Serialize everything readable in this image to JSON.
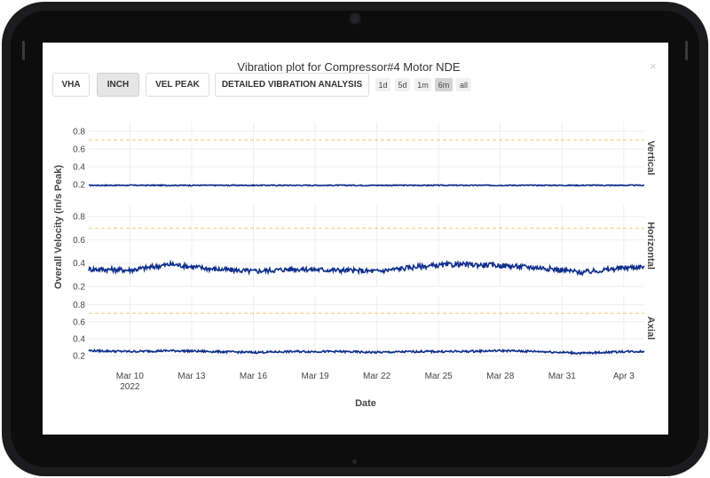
{
  "title": "Vibration plot for Compressor#4 Motor NDE",
  "close_icon": "×",
  "buttons": [
    {
      "label": "VHA",
      "active": false
    },
    {
      "label": "INCH",
      "active": true
    },
    {
      "label": "VEL PEAK",
      "active": false
    },
    {
      "label": "DETAILED VIBRATION ANALYSIS",
      "active": false
    }
  ],
  "range_selector": [
    {
      "label": "1d",
      "active": false
    },
    {
      "label": "5d",
      "active": false
    },
    {
      "label": "1m",
      "active": false
    },
    {
      "label": "6m",
      "active": true
    },
    {
      "label": "all",
      "active": false
    }
  ],
  "chart_data": {
    "type": "line",
    "ylabel": "Overall Velocity (in/s Peak)",
    "xlabel": "Date",
    "x_range": [
      "2022-03-08",
      "2022-04-04"
    ],
    "x_ticks": [
      "Mar 10",
      "Mar 13",
      "Mar 16",
      "Mar 19",
      "Mar 22",
      "Mar 25",
      "Mar 28",
      "Mar 31",
      "Apr 3"
    ],
    "x_tick_sublabel": "2022",
    "line_color": "#0d2e8c",
    "threshold_color": "#f5c56a",
    "grid": true,
    "panels": [
      {
        "name": "Vertical",
        "ylim": [
          0.1,
          0.9
        ],
        "yticks": [
          "0.2",
          "0.4",
          "0.6",
          "0.8"
        ],
        "threshold": 0.7,
        "x": [
          "2022-03-08",
          "2022-03-10",
          "2022-03-12",
          "2022-03-14",
          "2022-03-16",
          "2022-03-18",
          "2022-03-20",
          "2022-03-22",
          "2022-03-24",
          "2022-03-26",
          "2022-03-28",
          "2022-03-30",
          "2022-04-01",
          "2022-04-03",
          "2022-04-04"
        ],
        "y": [
          0.19,
          0.19,
          0.19,
          0.19,
          0.19,
          0.19,
          0.19,
          0.19,
          0.19,
          0.19,
          0.19,
          0.19,
          0.19,
          0.19,
          0.19
        ]
      },
      {
        "name": "Horizontal",
        "ylim": [
          0.2,
          0.9
        ],
        "yticks": [
          "0.2",
          "0.4",
          "0.6",
          "0.8"
        ],
        "threshold": 0.7,
        "x": [
          "2022-03-08",
          "2022-03-10",
          "2022-03-12",
          "2022-03-14",
          "2022-03-16",
          "2022-03-18",
          "2022-03-20",
          "2022-03-22",
          "2022-03-24",
          "2022-03-26",
          "2022-03-28",
          "2022-03-30",
          "2022-04-01",
          "2022-04-03",
          "2022-04-04"
        ],
        "y": [
          0.35,
          0.34,
          0.39,
          0.35,
          0.33,
          0.35,
          0.34,
          0.33,
          0.37,
          0.39,
          0.38,
          0.36,
          0.32,
          0.36,
          0.37
        ]
      },
      {
        "name": "Axial",
        "ylim": [
          0.15,
          0.9
        ],
        "yticks": [
          "0.2",
          "0.4",
          "0.6",
          "0.8"
        ],
        "threshold": 0.7,
        "x": [
          "2022-03-08",
          "2022-03-10",
          "2022-03-12",
          "2022-03-14",
          "2022-03-16",
          "2022-03-18",
          "2022-03-20",
          "2022-03-22",
          "2022-03-24",
          "2022-03-26",
          "2022-03-28",
          "2022-03-30",
          "2022-04-01",
          "2022-04-03",
          "2022-04-04"
        ],
        "y": [
          0.26,
          0.25,
          0.26,
          0.25,
          0.24,
          0.25,
          0.25,
          0.24,
          0.25,
          0.25,
          0.26,
          0.25,
          0.23,
          0.25,
          0.25
        ]
      }
    ]
  }
}
